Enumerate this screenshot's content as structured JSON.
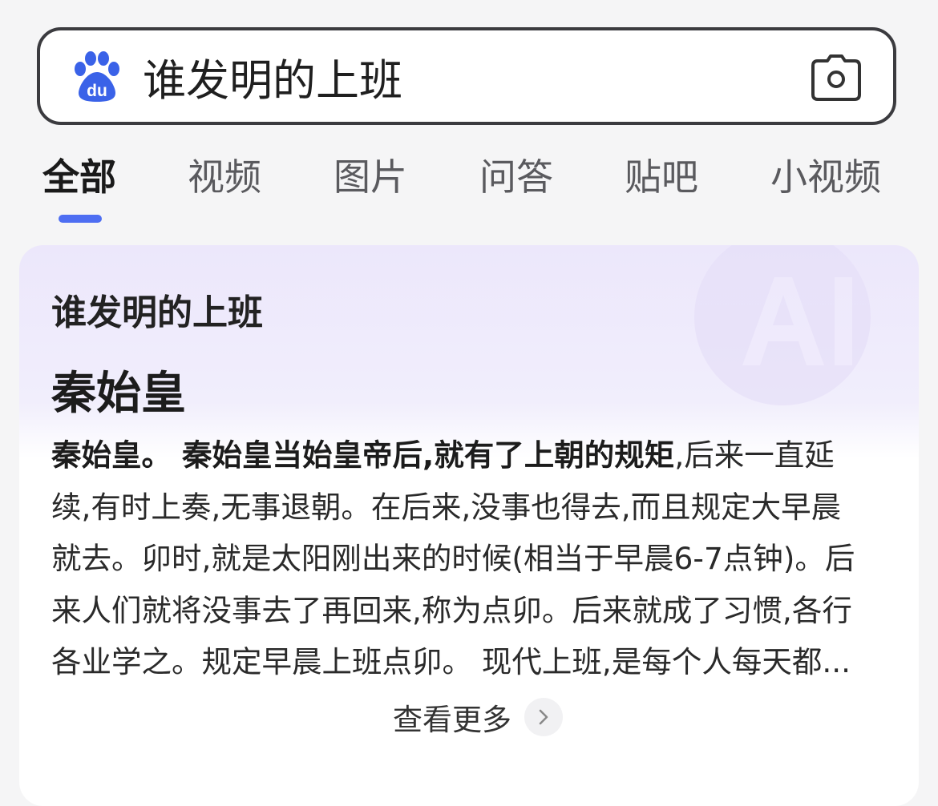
{
  "search": {
    "query": "谁发明的上班",
    "logo_icon": "baidu-paw-logo",
    "camera_icon": "camera-icon"
  },
  "tabs": [
    {
      "label": "全部",
      "active": true
    },
    {
      "label": "视频",
      "active": false
    },
    {
      "label": "图片",
      "active": false
    },
    {
      "label": "问答",
      "active": false
    },
    {
      "label": "贴吧",
      "active": false
    },
    {
      "label": "小视频",
      "active": false
    }
  ],
  "card": {
    "question": "谁发明的上班",
    "answer": "秦始皇",
    "lines": [
      {
        "bold": "秦始皇。 秦始皇当始皇帝后,就有了上朝的规矩",
        "text": ",后来一直延"
      },
      {
        "text": "续,有时上奏,无事退朝。在后来,没事也得去,而且规定大早晨"
      },
      {
        "text": "就去。卯时,就是太阳刚出来的时候(相当于早晨6-7点钟)。后"
      },
      {
        "text": "来人们就将没事去了再回来,称为点卯。后来就成了习惯,各行"
      },
      {
        "text": "各业学之。规定早晨上班点卯。 现代上班,是每个人每天都..."
      }
    ],
    "see_more": "查看更多"
  },
  "colors": {
    "accent": "#4e6ef2",
    "border": "#3b3b3f",
    "card_top": "#ece7fb"
  }
}
